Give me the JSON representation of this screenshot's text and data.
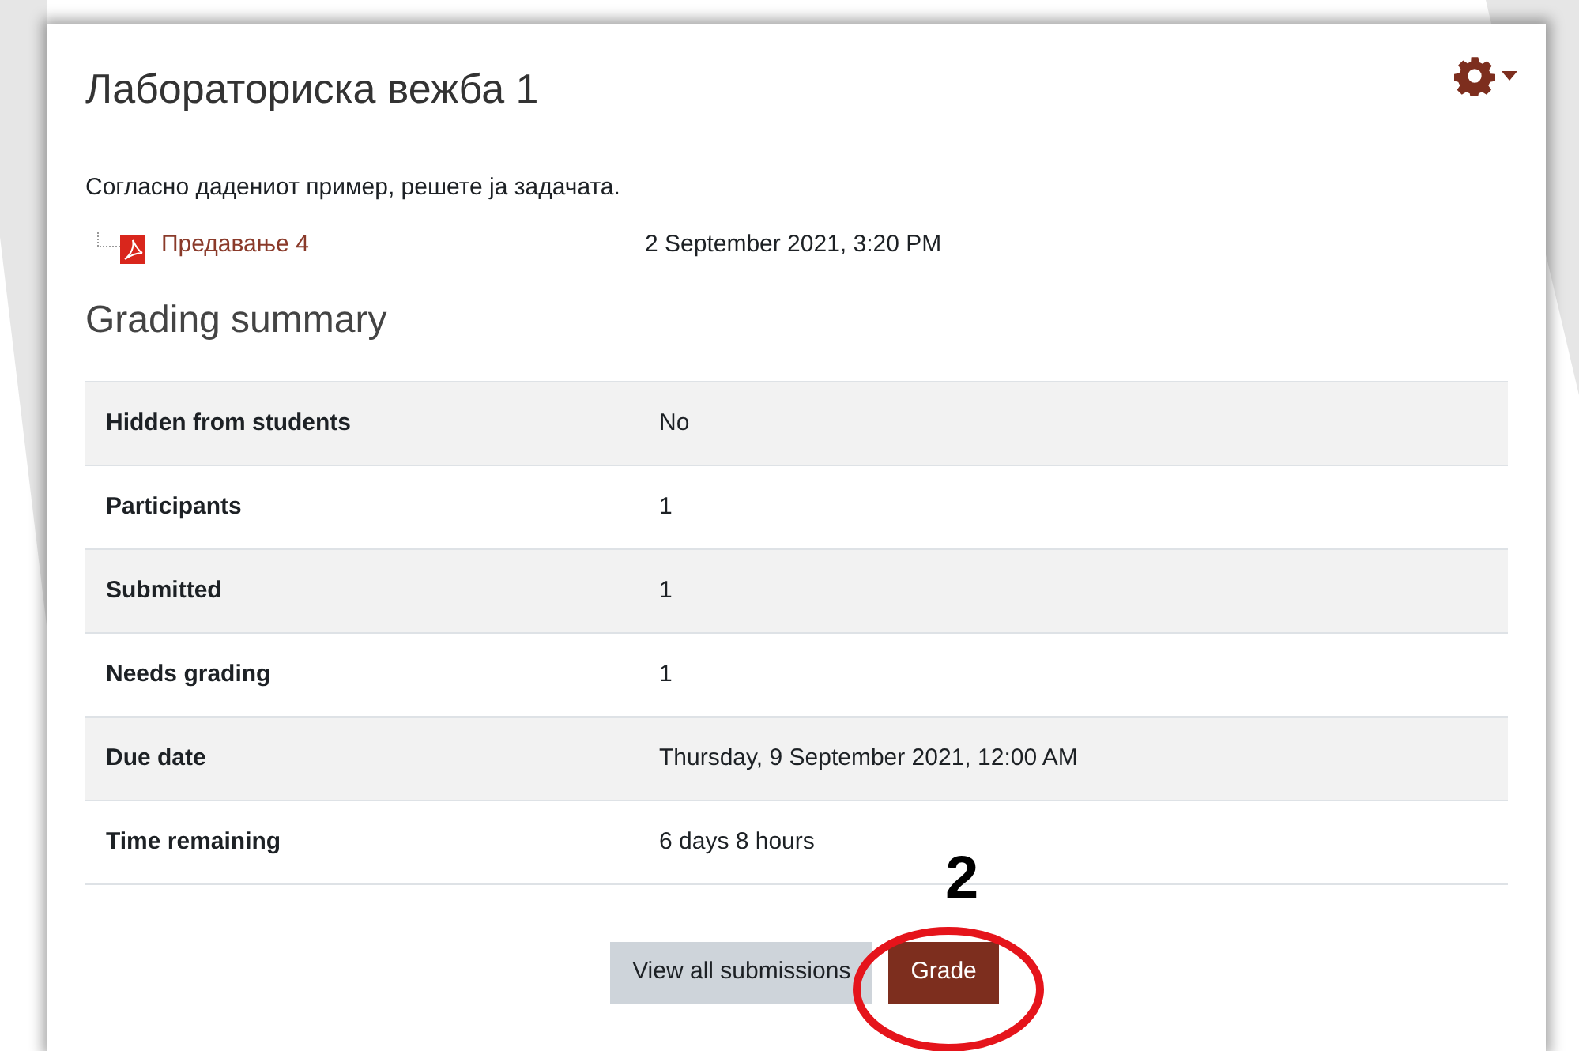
{
  "title": "Лабораториска вежба 1",
  "description": "Согласно дадениот пример, решете ја задачата.",
  "file": {
    "name": "Предавање 4",
    "date": "2 September 2021, 3:20 PM"
  },
  "heading": "Grading summary",
  "table": {
    "rows": [
      {
        "label": "Hidden from students",
        "value": "No"
      },
      {
        "label": "Participants",
        "value": "1"
      },
      {
        "label": "Submitted",
        "value": "1"
      },
      {
        "label": "Needs grading",
        "value": "1"
      },
      {
        "label": "Due date",
        "value": "Thursday, 9 September 2021, 12:00 AM"
      },
      {
        "label": "Time remaining",
        "value": "6 days 8 hours"
      }
    ]
  },
  "buttons": [
    {
      "label": "View all submissions",
      "kind": "secondary"
    },
    {
      "label": "Grade",
      "kind": "primary"
    }
  ],
  "annotation": {
    "number": "2"
  }
}
